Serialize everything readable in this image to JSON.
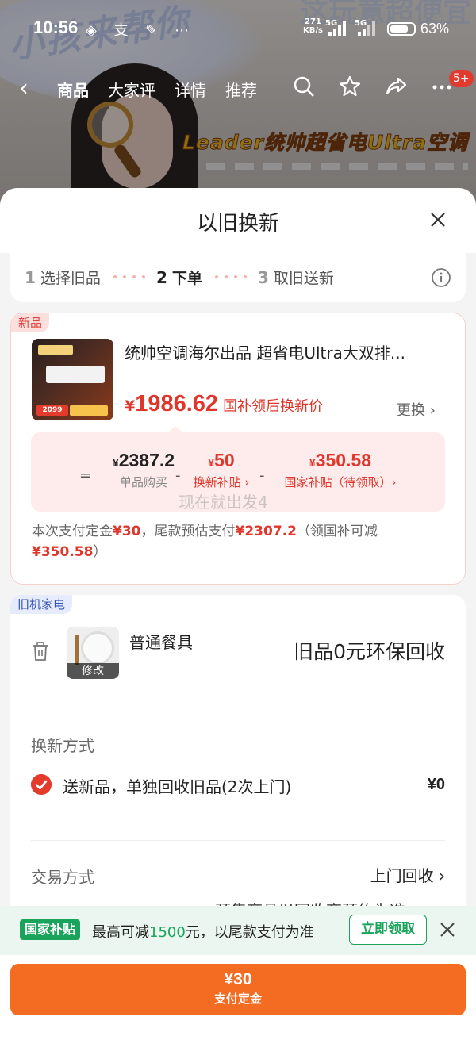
{
  "status_bar": {
    "time": "10:56",
    "net_speed": "271",
    "net_unit": "KB/s",
    "sig1": "5G",
    "sig2": "5G",
    "battery": "63%"
  },
  "nav": {
    "tabs": [
      "商品",
      "大家评",
      "详情",
      "推荐"
    ],
    "badge": "5+"
  },
  "background": {
    "banner": "Leader统帅超省电Ultra空调",
    "bg_text": "小孩来帮你",
    "bg_text2": "这玩意超便宜"
  },
  "sheet": {
    "title": "以旧换新",
    "steps": [
      {
        "num": "1",
        "label": "选择旧品"
      },
      {
        "num": "2",
        "label": "下单"
      },
      {
        "num": "3",
        "label": "取旧送新"
      }
    ]
  },
  "product": {
    "tag": "新品",
    "title": "统帅空调海尔出品 超省电Ultra大双排...",
    "img_price": "2099",
    "price_symbol": "¥",
    "price": "1986.62",
    "price_note": "国补领后换新价",
    "change_label": "更换",
    "calc": {
      "equals": "=",
      "minus": "-",
      "base_yen": "¥",
      "base_value": "2387.2",
      "base_label": "单品购买",
      "subsidy_yen": "¥",
      "subsidy_value": "50",
      "subsidy_label": "换新补贴 ›",
      "national_yen": "¥",
      "national_value": "350.58",
      "national_label": "国家补贴（待领取）›"
    },
    "watermark": "现在就出发4",
    "pay_note": {
      "p1": "本次支付定金",
      "deposit": "¥30",
      "p2": "，尾款预估支付",
      "final": "¥2307.2",
      "p3": "（领国补可减",
      "reduce": "¥350.58",
      "p4": "）"
    }
  },
  "old_item": {
    "tag": "旧机家电",
    "name": "普通餐具",
    "edit_label": "修改",
    "recycle": "旧品0元环保回收",
    "method_label": "换新方式",
    "option_text": "送新品，单独回收旧品(2次上门)",
    "option_price": "¥0",
    "trade_label": "交易方式",
    "trade_value": "上门回收",
    "clipped_text": "预售商品以回收商预约为准"
  },
  "subsidy_banner": {
    "tag": "国家补贴",
    "text_pre": "最高可减",
    "amount": "1500",
    "text_post": "元，以尾款支付为准",
    "button": "立即领取"
  },
  "bottom": {
    "amount": "¥30",
    "label": "支付定金"
  },
  "colors": {
    "accent_red": "#e0372c",
    "pay_orange": "#f36c21",
    "subsidy_green": "#1aa35b"
  }
}
